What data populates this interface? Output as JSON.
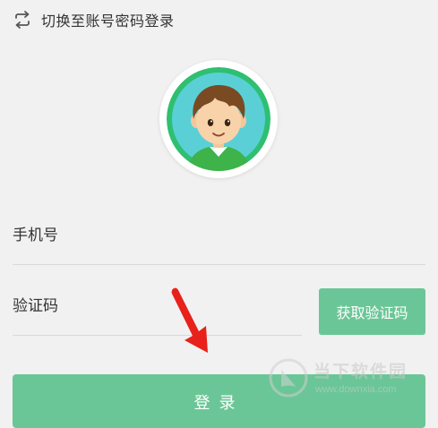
{
  "header": {
    "switch_label": "切换至账号密码登录",
    "switch_icon": "swap-icon"
  },
  "avatar": {
    "icon": "cartoon-boy-avatar",
    "ring_color": "#2fbf71"
  },
  "form": {
    "phone_label": "手机号",
    "code_label": "验证码",
    "get_code_label": "获取验证码"
  },
  "actions": {
    "login_label": "登录"
  },
  "colors": {
    "accent": "#6bc697",
    "background": "#f1f1f1",
    "arrow": "#e8211b"
  },
  "watermark": {
    "name": "当下软件园",
    "url": "www.downxia.com"
  }
}
